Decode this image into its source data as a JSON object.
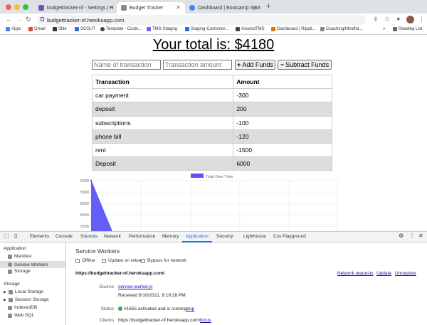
{
  "browser": {
    "tabs": [
      {
        "title": "budgettracker-nf - Settings | H",
        "favicon_color": "#7952b3",
        "active": false
      },
      {
        "title": "Budget Tracker",
        "favicon_color": "#888888",
        "active": true
      },
      {
        "title": "Dashboard | Bootcamp Spot",
        "favicon_color": "#4285f4",
        "active": false
      }
    ],
    "new_tab": "+",
    "url": "budgettracker-nf.herokuapp.com",
    "bookmarks": [
      {
        "label": "Apps",
        "color": "#4285f4"
      },
      {
        "label": "Gmail",
        "color": "#ea4335"
      },
      {
        "label": "Slite",
        "color": "#333333"
      },
      {
        "label": "SCOUT",
        "color": "#2d6cdf"
      },
      {
        "label": "Template - Custo...",
        "color": "#444444"
      },
      {
        "label": "TMS-Staigng",
        "color": "#7a5cff"
      },
      {
        "label": "Staging-Customer...",
        "color": "#1a73e8"
      },
      {
        "label": "AscendTMS",
        "color": "#444444"
      },
      {
        "label": "Dashboard | Rippli...",
        "color": "#e37400"
      },
      {
        "label": "Coaching/Mindful...",
        "color": "#888888"
      }
    ],
    "reading_list": "Reading List",
    "more": "»"
  },
  "app": {
    "total_label": "Your total is: $4180",
    "name_placeholder": "Name of transaction",
    "amount_placeholder": "Transaction amount",
    "add_button": "Add Funds",
    "subtract_button": "Subtract Funds",
    "table": {
      "headers": [
        "Transaction",
        "Amount"
      ],
      "rows": [
        [
          "car payment",
          "-300"
        ],
        [
          "deposit",
          "200"
        ],
        [
          "subscriptions",
          "-100"
        ],
        [
          "phone bill",
          "-120"
        ],
        [
          "rent",
          "-1500"
        ],
        [
          "Deposit",
          "6000"
        ]
      ]
    }
  },
  "chart_data": {
    "type": "area",
    "legend": "Total Over Time",
    "series_color": "#5b55f6",
    "yticks": [
      6000,
      5800,
      5600,
      5400,
      5200,
      5000
    ],
    "ylim": [
      4980,
      6000
    ],
    "series": [
      {
        "name": "Total Over Time",
        "values": [
          6000,
          5000
        ]
      }
    ]
  },
  "devtools": {
    "tabs": [
      "Elements",
      "Console",
      "Sources",
      "Network",
      "Performance",
      "Memory",
      "Application",
      "Security",
      "Lighthouse",
      "Css Playground"
    ],
    "active_tab": "Application",
    "sidebar": {
      "application_header": "Application",
      "application_items": [
        "Manifest",
        "Service Workers",
        "Storage"
      ],
      "storage_header": "Storage",
      "storage_items": [
        "Local Storage",
        "Session Storage",
        "IndexedDB",
        "Web SQL"
      ]
    },
    "service_workers": {
      "title": "Service Workers",
      "options": [
        "Offline",
        "Update on reload",
        "Bypass for network"
      ],
      "origin": "https://budgettracker-nf.herokuapp.com/",
      "actions": [
        "Network requests",
        "Update",
        "Unregister"
      ],
      "source_label": "Source",
      "source_link": "service-worker.js",
      "received": "Received 6/10/2021, 8:19:28 PM",
      "status_label": "Status",
      "status_text": "#1655 activated and is running",
      "status_action": "stop",
      "clients_label": "Clients",
      "clients_value": "https://budgettracker-nf.herokuapp.com/",
      "clients_action": "focus"
    }
  }
}
